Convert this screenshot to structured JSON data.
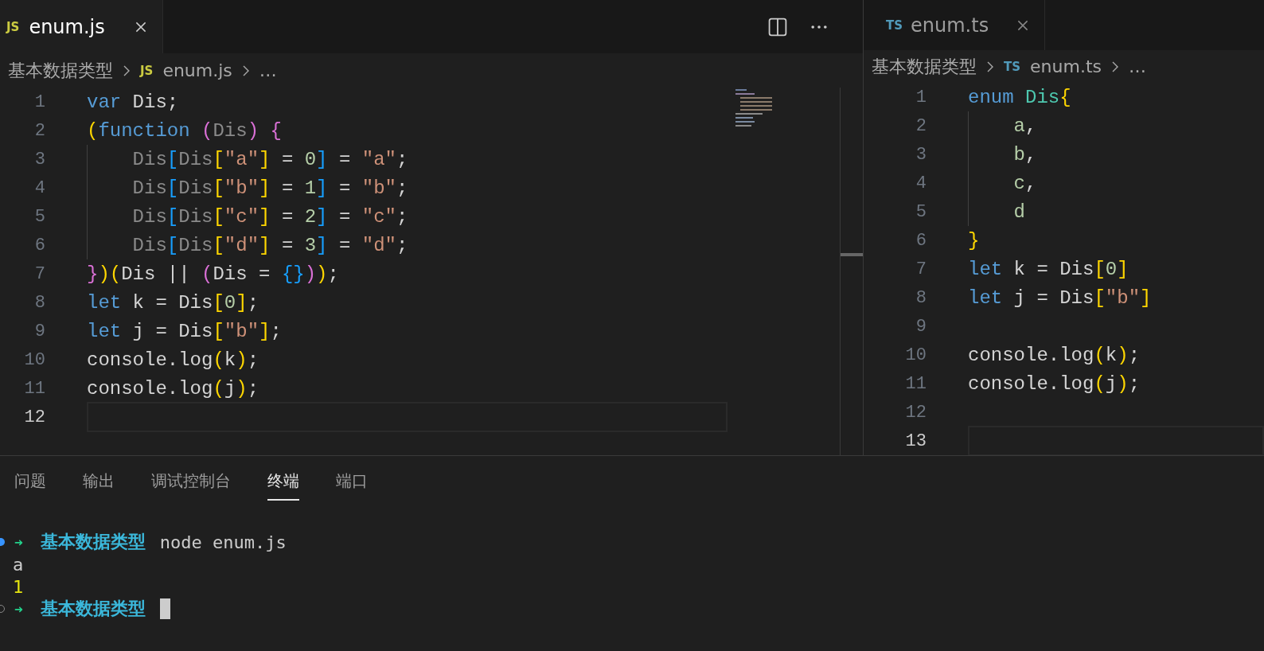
{
  "editors": [
    {
      "tab": {
        "icon": "JS",
        "label": "enum.js",
        "selected": true
      },
      "breadcrumb": {
        "folder": "基本数据类型",
        "icon": "JS",
        "file": "enum.js",
        "more": "…"
      },
      "minimap": true,
      "lines": [
        {
          "number": "1",
          "tokens": [
            {
              "t": "var ",
              "kind": "keyword"
            },
            {
              "t": "Dis;",
              "kind": "plain"
            }
          ]
        },
        {
          "number": "2",
          "tokens": [
            {
              "t": "(",
              "kind": "b1"
            },
            {
              "t": "function ",
              "kind": "keyword"
            },
            {
              "t": "(",
              "kind": "b2"
            },
            {
              "t": "Dis",
              "kind": "dim"
            },
            {
              "t": ") {",
              "kind": "b2"
            }
          ]
        },
        {
          "number": "3",
          "guide": true,
          "tokens": [
            {
              "t": "    Dis",
              "kind": "dim"
            },
            {
              "t": "[",
              "kind": "b3"
            },
            {
              "t": "Dis",
              "kind": "dim"
            },
            {
              "t": "[",
              "kind": "b1"
            },
            {
              "t": "\"a\"",
              "kind": "string"
            },
            {
              "t": "]",
              "kind": "b1"
            },
            {
              "t": " = ",
              "kind": "plain"
            },
            {
              "t": "0",
              "kind": "number"
            },
            {
              "t": "]",
              "kind": "b3"
            },
            {
              "t": " = ",
              "kind": "plain"
            },
            {
              "t": "\"a\"",
              "kind": "string"
            },
            {
              "t": ";",
              "kind": "plain"
            }
          ]
        },
        {
          "number": "4",
          "guide": true,
          "tokens": [
            {
              "t": "    Dis",
              "kind": "dim"
            },
            {
              "t": "[",
              "kind": "b3"
            },
            {
              "t": "Dis",
              "kind": "dim"
            },
            {
              "t": "[",
              "kind": "b1"
            },
            {
              "t": "\"b\"",
              "kind": "string"
            },
            {
              "t": "]",
              "kind": "b1"
            },
            {
              "t": " = ",
              "kind": "plain"
            },
            {
              "t": "1",
              "kind": "number"
            },
            {
              "t": "]",
              "kind": "b3"
            },
            {
              "t": " = ",
              "kind": "plain"
            },
            {
              "t": "\"b\"",
              "kind": "string"
            },
            {
              "t": ";",
              "kind": "plain"
            }
          ]
        },
        {
          "number": "5",
          "guide": true,
          "tokens": [
            {
              "t": "    Dis",
              "kind": "dim"
            },
            {
              "t": "[",
              "kind": "b3"
            },
            {
              "t": "Dis",
              "kind": "dim"
            },
            {
              "t": "[",
              "kind": "b1"
            },
            {
              "t": "\"c\"",
              "kind": "string"
            },
            {
              "t": "]",
              "kind": "b1"
            },
            {
              "t": " = ",
              "kind": "plain"
            },
            {
              "t": "2",
              "kind": "number"
            },
            {
              "t": "]",
              "kind": "b3"
            },
            {
              "t": " = ",
              "kind": "plain"
            },
            {
              "t": "\"c\"",
              "kind": "string"
            },
            {
              "t": ";",
              "kind": "plain"
            }
          ]
        },
        {
          "number": "6",
          "guide": true,
          "tokens": [
            {
              "t": "    Dis",
              "kind": "dim"
            },
            {
              "t": "[",
              "kind": "b3"
            },
            {
              "t": "Dis",
              "kind": "dim"
            },
            {
              "t": "[",
              "kind": "b1"
            },
            {
              "t": "\"d\"",
              "kind": "string"
            },
            {
              "t": "]",
              "kind": "b1"
            },
            {
              "t": " = ",
              "kind": "plain"
            },
            {
              "t": "3",
              "kind": "number"
            },
            {
              "t": "]",
              "kind": "b3"
            },
            {
              "t": " = ",
              "kind": "plain"
            },
            {
              "t": "\"d\"",
              "kind": "string"
            },
            {
              "t": ";",
              "kind": "plain"
            }
          ]
        },
        {
          "number": "7",
          "tokens": [
            {
              "t": "}",
              "kind": "b2"
            },
            {
              "t": ")(",
              "kind": "b1"
            },
            {
              "t": "Dis || ",
              "kind": "plain"
            },
            {
              "t": "(",
              "kind": "b2"
            },
            {
              "t": "Dis = ",
              "kind": "plain"
            },
            {
              "t": "{}",
              "kind": "b3"
            },
            {
              "t": ")",
              "kind": "b2"
            },
            {
              "t": ")",
              "kind": "b1"
            },
            {
              "t": ";",
              "kind": "plain"
            }
          ]
        },
        {
          "number": "8",
          "tokens": [
            {
              "t": "let ",
              "kind": "keyword"
            },
            {
              "t": "k = Dis",
              "kind": "plain"
            },
            {
              "t": "[",
              "kind": "b1"
            },
            {
              "t": "0",
              "kind": "number"
            },
            {
              "t": "]",
              "kind": "b1"
            },
            {
              "t": ";",
              "kind": "plain"
            }
          ]
        },
        {
          "number": "9",
          "tokens": [
            {
              "t": "let ",
              "kind": "keyword"
            },
            {
              "t": "j = Dis",
              "kind": "plain"
            },
            {
              "t": "[",
              "kind": "b1"
            },
            {
              "t": "\"b\"",
              "kind": "string"
            },
            {
              "t": "]",
              "kind": "b1"
            },
            {
              "t": ";",
              "kind": "plain"
            }
          ]
        },
        {
          "number": "10",
          "tokens": [
            {
              "t": "console.log",
              "kind": "plain"
            },
            {
              "t": "(",
              "kind": "b1"
            },
            {
              "t": "k",
              "kind": "plain"
            },
            {
              "t": ")",
              "kind": "b1"
            },
            {
              "t": ";",
              "kind": "plain"
            }
          ]
        },
        {
          "number": "11",
          "tokens": [
            {
              "t": "console.log",
              "kind": "plain"
            },
            {
              "t": "(",
              "kind": "b1"
            },
            {
              "t": "j",
              "kind": "plain"
            },
            {
              "t": ")",
              "kind": "b1"
            },
            {
              "t": ";",
              "kind": "plain"
            }
          ]
        },
        {
          "number": "12",
          "current": true
        }
      ]
    },
    {
      "tab": {
        "icon": "TS",
        "label": "enum.ts",
        "selected": false
      },
      "breadcrumb": {
        "folder": "基本数据类型",
        "icon": "TS",
        "file": "enum.ts",
        "more": "…"
      },
      "minimap": false,
      "lines": [
        {
          "number": "1",
          "tokens": [
            {
              "t": "enum ",
              "kind": "keyword"
            },
            {
              "t": "Dis",
              "kind": "type"
            },
            {
              "t": "{",
              "kind": "b1"
            }
          ]
        },
        {
          "number": "2",
          "guide": true,
          "tokens": [
            {
              "t": "    a",
              "kind": "member"
            },
            {
              "t": ",",
              "kind": "plain"
            }
          ]
        },
        {
          "number": "3",
          "guide": true,
          "tokens": [
            {
              "t": "    b",
              "kind": "member"
            },
            {
              "t": ",",
              "kind": "plain"
            }
          ]
        },
        {
          "number": "4",
          "guide": true,
          "tokens": [
            {
              "t": "    c",
              "kind": "member"
            },
            {
              "t": ",",
              "kind": "plain"
            }
          ]
        },
        {
          "number": "5",
          "guide": true,
          "tokens": [
            {
              "t": "    d",
              "kind": "member"
            }
          ]
        },
        {
          "number": "6",
          "tokens": [
            {
              "t": "}",
              "kind": "b1"
            }
          ]
        },
        {
          "number": "7",
          "tokens": [
            {
              "t": "let ",
              "kind": "keyword"
            },
            {
              "t": "k = Dis",
              "kind": "plain"
            },
            {
              "t": "[",
              "kind": "b1"
            },
            {
              "t": "0",
              "kind": "number"
            },
            {
              "t": "]",
              "kind": "b1"
            }
          ]
        },
        {
          "number": "8",
          "tokens": [
            {
              "t": "let ",
              "kind": "keyword"
            },
            {
              "t": "j = Dis",
              "kind": "plain"
            },
            {
              "t": "[",
              "kind": "b1"
            },
            {
              "t": "\"b\"",
              "kind": "string"
            },
            {
              "t": "]",
              "kind": "b1"
            }
          ]
        },
        {
          "number": "9"
        },
        {
          "number": "10",
          "tokens": [
            {
              "t": "console.log",
              "kind": "plain"
            },
            {
              "t": "(",
              "kind": "b1"
            },
            {
              "t": "k",
              "kind": "plain"
            },
            {
              "t": ")",
              "kind": "b1"
            },
            {
              "t": ";",
              "kind": "plain"
            }
          ]
        },
        {
          "number": "11",
          "tokens": [
            {
              "t": "console.log",
              "kind": "plain"
            },
            {
              "t": "(",
              "kind": "b1"
            },
            {
              "t": "j",
              "kind": "plain"
            },
            {
              "t": ")",
              "kind": "b1"
            },
            {
              "t": ";",
              "kind": "plain"
            }
          ]
        },
        {
          "number": "12"
        },
        {
          "number": "13",
          "current": true
        }
      ]
    }
  ],
  "panel": {
    "tabs": [
      {
        "label": "问题",
        "selected": false
      },
      {
        "label": "输出",
        "selected": false
      },
      {
        "label": "调试控制台",
        "selected": false
      },
      {
        "label": "终端",
        "selected": true
      },
      {
        "label": "端口",
        "selected": false
      }
    ],
    "terminal": [
      {
        "kind": "prompt",
        "succeeded": true,
        "arrow": "➜",
        "dir": "基本数据类型",
        "command": "node enum.js"
      },
      {
        "kind": "output",
        "text": "a",
        "color": "#cccccc"
      },
      {
        "kind": "output",
        "text": "1",
        "color": "#e5e510"
      },
      {
        "kind": "prompt",
        "succeeded": false,
        "arrow": "➜",
        "dir": "基本数据类型",
        "cursor": true
      }
    ]
  }
}
